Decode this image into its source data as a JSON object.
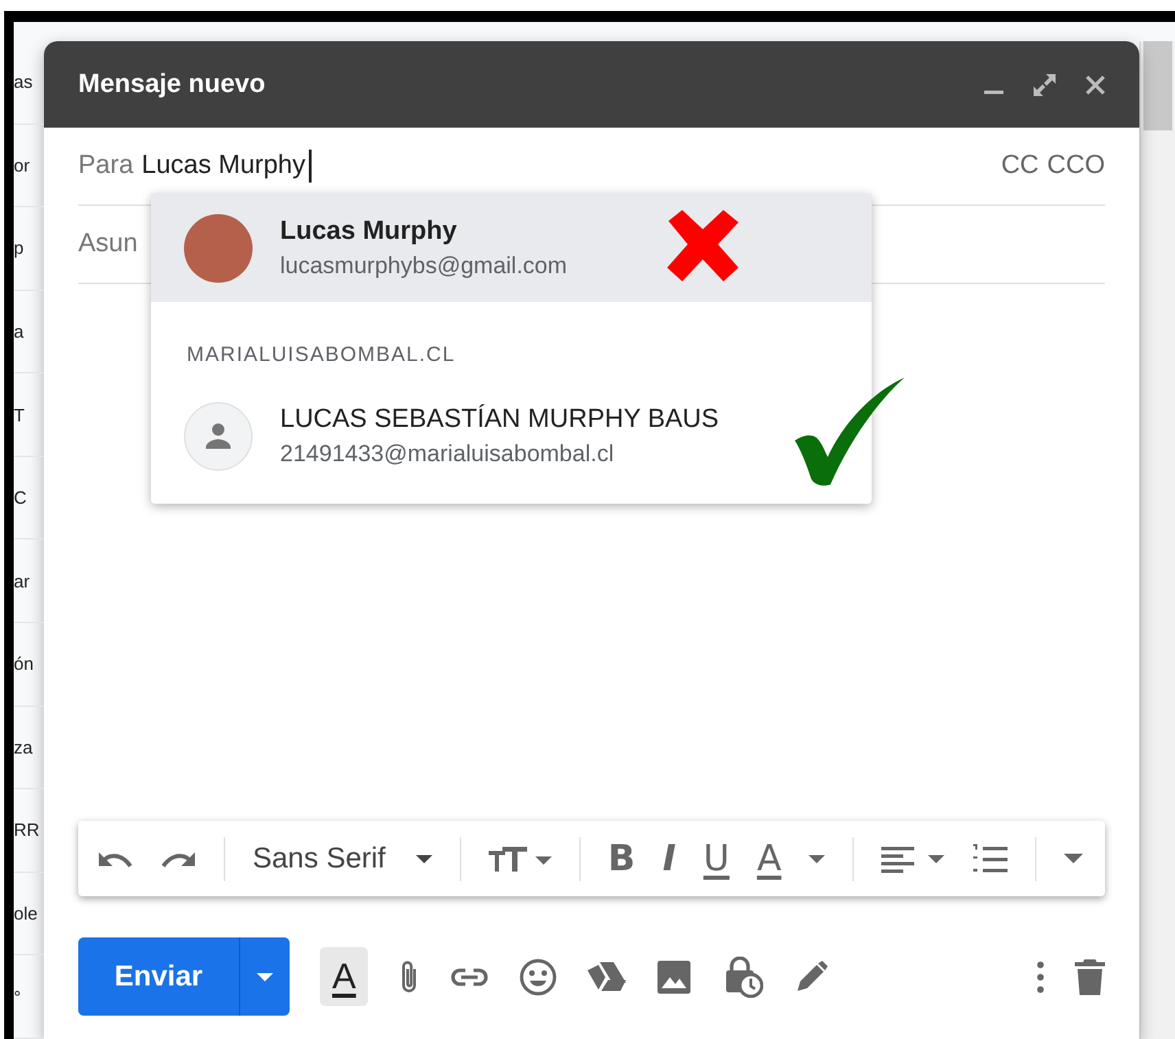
{
  "background_list": [
    "as",
    "or",
    "p",
    "a",
    "T",
    "C",
    "ar",
    "ón",
    "za",
    "RR",
    "ole",
    "°"
  ],
  "compose": {
    "title": "Mensaje nuevo",
    "to": {
      "label": "Para",
      "value": "Lucas Murphy",
      "extras": [
        "CC",
        "CCO"
      ]
    },
    "subject": {
      "placeholder": "Asun"
    },
    "suggestions": [
      {
        "kind": "contact",
        "name": "Lucas Murphy",
        "email": "lucasmurphybs@gmail.com",
        "has_photo": true,
        "selected": true
      },
      {
        "kind": "section",
        "label": "MARIALUISABOMBAL.CL"
      },
      {
        "kind": "contact",
        "name": "LUCAS SEBASTÍAN MURPHY BAUS",
        "email": "21491433@marialuisabombal.cl",
        "has_photo": false,
        "selected": false
      }
    ],
    "annotations": [
      {
        "kind": "cross",
        "color": "#ff0000"
      },
      {
        "kind": "check",
        "color": "#0a6e0a"
      }
    ],
    "toolbar": {
      "font": "Sans Serif",
      "format_buttons": [
        {
          "kind": "bold",
          "glyph": "B"
        },
        {
          "kind": "italic",
          "glyph": "I"
        },
        {
          "kind": "underline",
          "glyph": "U"
        },
        {
          "kind": "color",
          "glyph": "A"
        }
      ]
    },
    "send_label": "Enviar",
    "format_toggle": {
      "glyph": "A",
      "selected": true
    }
  }
}
